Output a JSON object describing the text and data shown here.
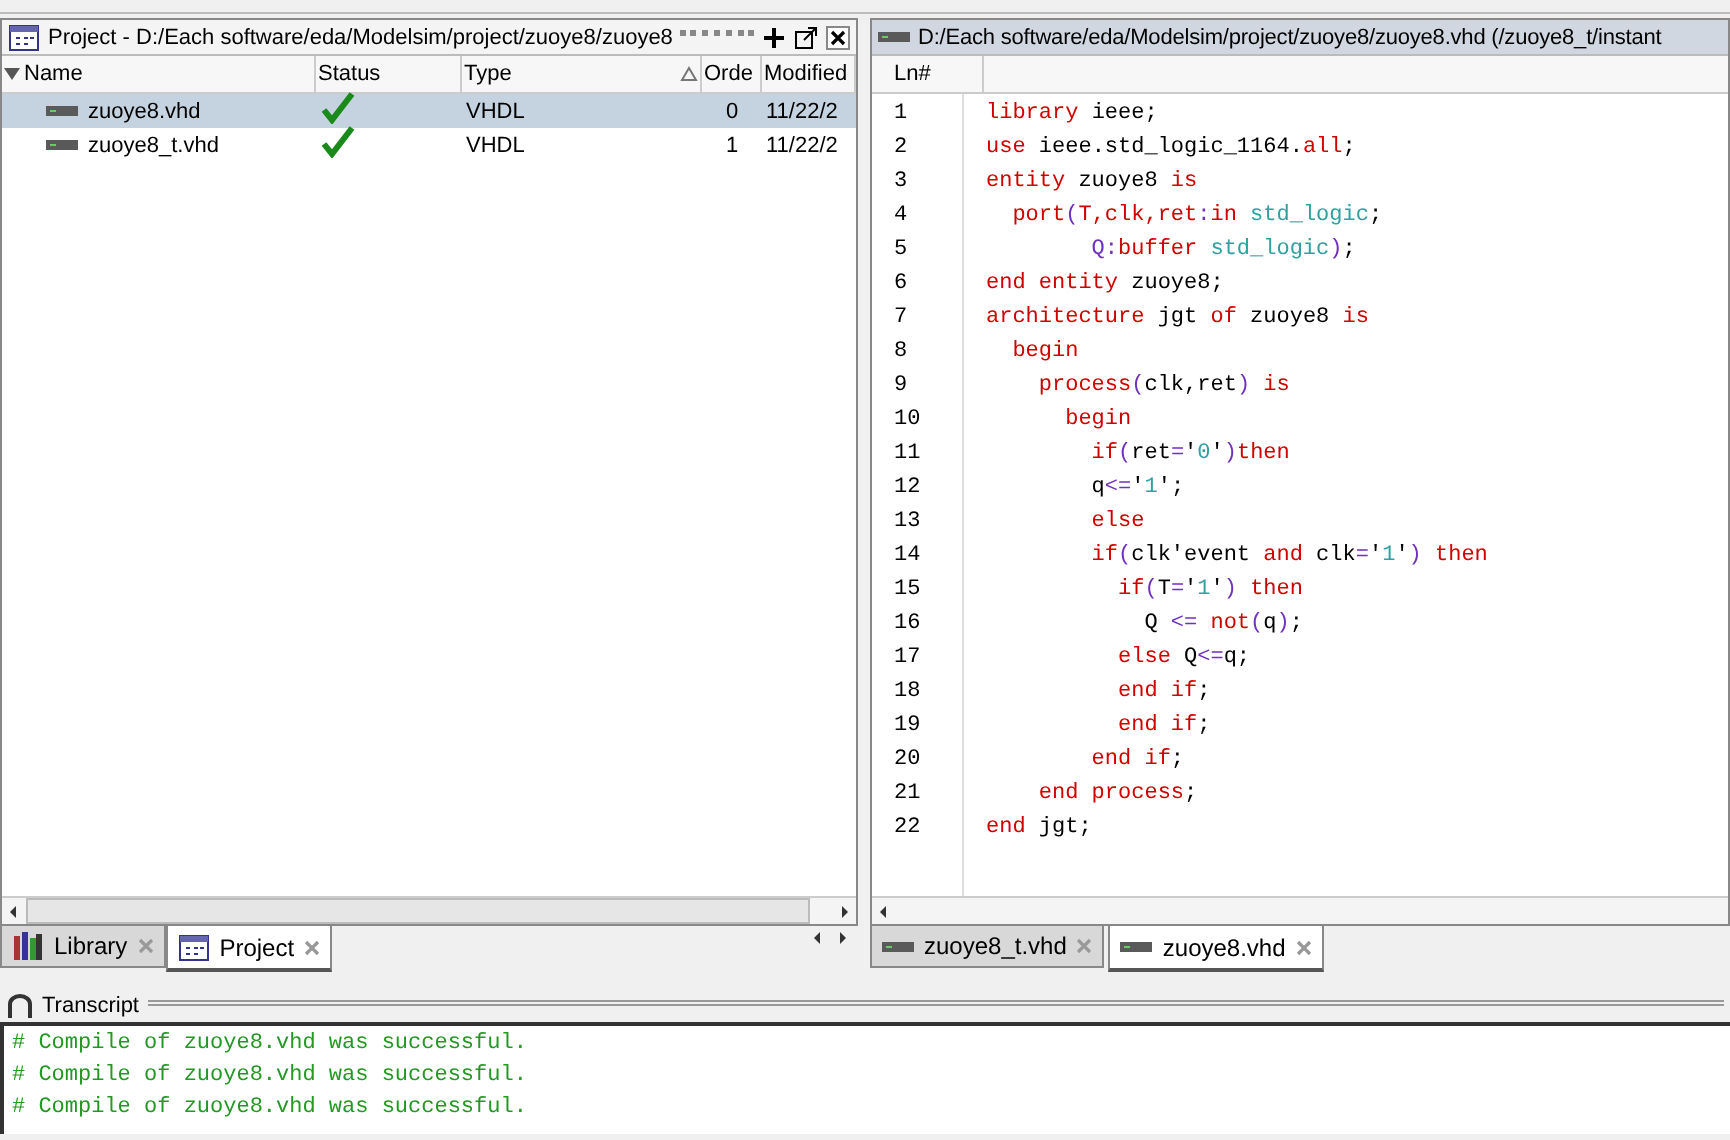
{
  "project_pane": {
    "title": "Project - D:/Each software/eda/Modelsim/project/zuoye8/zuoye8",
    "columns": [
      {
        "label": "Name",
        "sorted": false
      },
      {
        "label": "Status",
        "sorted": false
      },
      {
        "label": "Type",
        "sorted": true
      },
      {
        "label": "Orde",
        "sorted": false
      },
      {
        "label": "Modified",
        "sorted": false
      }
    ],
    "rows": [
      {
        "name": "zuoye8.vhd",
        "compiled": true,
        "type": "VHDL",
        "order": "0",
        "modified": "11/22/2",
        "selected": true
      },
      {
        "name": "zuoye8_t.vhd",
        "compiled": true,
        "type": "VHDL",
        "order": "1",
        "modified": "11/22/2",
        "selected": false
      }
    ],
    "tabs": [
      {
        "label": "Library",
        "kind": "library",
        "selected": false
      },
      {
        "label": "Project",
        "kind": "project",
        "selected": true
      }
    ]
  },
  "editor": {
    "title": "D:/Each software/eda/Modelsim/project/zuoye8/zuoye8.vhd (/zuoye8_t/instant",
    "line_header": "Ln#",
    "lines": [
      {
        "number": "1",
        "tokens": [
          {
            "kind": "keyword",
            "text": "library"
          },
          {
            "kind": "plain",
            "text": " ieee;"
          }
        ]
      },
      {
        "number": "2",
        "tokens": [
          {
            "kind": "keyword",
            "text": "use"
          },
          {
            "kind": "plain",
            "text": " ieee.std_logic_1164."
          },
          {
            "kind": "keyword",
            "text": "all"
          },
          {
            "kind": "plain",
            "text": ";"
          }
        ]
      },
      {
        "number": "3",
        "tokens": [
          {
            "kind": "keyword",
            "text": "entity"
          },
          {
            "kind": "plain",
            "text": " zuoye8 "
          },
          {
            "kind": "keyword",
            "text": "is"
          }
        ]
      },
      {
        "number": "4",
        "tokens": [
          {
            "kind": "keyword",
            "text": "  port"
          },
          {
            "kind": "symbol",
            "text": "("
          },
          {
            "kind": "keyword",
            "text": "T,clk,ret"
          },
          {
            "kind": "symbol",
            "text": ":"
          },
          {
            "kind": "keyword",
            "text": "in"
          },
          {
            "kind": "literal",
            "text": " std_logic"
          },
          {
            "kind": "plain",
            "text": ";"
          }
        ]
      },
      {
        "number": "5",
        "tokens": [
          {
            "kind": "symbol",
            "text": "        Q:"
          },
          {
            "kind": "keyword",
            "text": "buffer"
          },
          {
            "kind": "literal",
            "text": " std_logic"
          },
          {
            "kind": "symbol",
            "text": ")"
          },
          {
            "kind": "plain",
            "text": ";"
          }
        ]
      },
      {
        "number": "6",
        "tokens": [
          {
            "kind": "keyword",
            "text": "end entity"
          },
          {
            "kind": "plain",
            "text": " zuoye8;"
          }
        ]
      },
      {
        "number": "7",
        "tokens": [
          {
            "kind": "keyword",
            "text": "architecture"
          },
          {
            "kind": "plain",
            "text": " jgt "
          },
          {
            "kind": "keyword",
            "text": "of"
          },
          {
            "kind": "plain",
            "text": " zuoye8 "
          },
          {
            "kind": "keyword",
            "text": "is"
          }
        ]
      },
      {
        "number": "8",
        "tokens": [
          {
            "kind": "keyword",
            "text": "  begin"
          }
        ]
      },
      {
        "number": "9",
        "tokens": [
          {
            "kind": "keyword",
            "text": "    process"
          },
          {
            "kind": "symbol",
            "text": "("
          },
          {
            "kind": "plain",
            "text": "clk,ret"
          },
          {
            "kind": "symbol",
            "text": ")"
          },
          {
            "kind": "keyword",
            "text": " is"
          }
        ]
      },
      {
        "number": "10",
        "tokens": [
          {
            "kind": "keyword",
            "text": "      begin"
          }
        ]
      },
      {
        "number": "11",
        "tokens": [
          {
            "kind": "keyword",
            "text": "        if"
          },
          {
            "kind": "symbol",
            "text": "("
          },
          {
            "kind": "plain",
            "text": "ret"
          },
          {
            "kind": "symbol",
            "text": "="
          },
          {
            "kind": "plain",
            "text": "'"
          },
          {
            "kind": "literal",
            "text": "0"
          },
          {
            "kind": "plain",
            "text": "'"
          },
          {
            "kind": "symbol",
            "text": ")"
          },
          {
            "kind": "keyword",
            "text": "then"
          }
        ]
      },
      {
        "number": "12",
        "tokens": [
          {
            "kind": "plain",
            "text": "        q"
          },
          {
            "kind": "symbol",
            "text": "<="
          },
          {
            "kind": "plain",
            "text": "'"
          },
          {
            "kind": "literal",
            "text": "1"
          },
          {
            "kind": "plain",
            "text": "';"
          }
        ]
      },
      {
        "number": "13",
        "tokens": [
          {
            "kind": "keyword",
            "text": "        else"
          }
        ]
      },
      {
        "number": "14",
        "tokens": [
          {
            "kind": "keyword",
            "text": "        if"
          },
          {
            "kind": "symbol",
            "text": "("
          },
          {
            "kind": "plain",
            "text": "clk'event "
          },
          {
            "kind": "keyword",
            "text": "and"
          },
          {
            "kind": "plain",
            "text": " clk"
          },
          {
            "kind": "symbol",
            "text": "="
          },
          {
            "kind": "plain",
            "text": "'"
          },
          {
            "kind": "literal",
            "text": "1"
          },
          {
            "kind": "plain",
            "text": "'"
          },
          {
            "kind": "symbol",
            "text": ")"
          },
          {
            "kind": "keyword",
            "text": " then"
          }
        ]
      },
      {
        "number": "15",
        "tokens": [
          {
            "kind": "keyword",
            "text": "          if"
          },
          {
            "kind": "symbol",
            "text": "("
          },
          {
            "kind": "plain",
            "text": "T"
          },
          {
            "kind": "symbol",
            "text": "="
          },
          {
            "kind": "plain",
            "text": "'"
          },
          {
            "kind": "literal",
            "text": "1"
          },
          {
            "kind": "plain",
            "text": "'"
          },
          {
            "kind": "symbol",
            "text": ")"
          },
          {
            "kind": "keyword",
            "text": " then"
          }
        ]
      },
      {
        "number": "16",
        "tokens": [
          {
            "kind": "plain",
            "text": "            Q "
          },
          {
            "kind": "symbol",
            "text": "<="
          },
          {
            "kind": "keyword",
            "text": " not"
          },
          {
            "kind": "symbol",
            "text": "("
          },
          {
            "kind": "plain",
            "text": "q"
          },
          {
            "kind": "symbol",
            "text": ")"
          },
          {
            "kind": "plain",
            "text": ";"
          }
        ]
      },
      {
        "number": "17",
        "tokens": [
          {
            "kind": "keyword",
            "text": "          else"
          },
          {
            "kind": "plain",
            "text": " Q"
          },
          {
            "kind": "symbol",
            "text": "<="
          },
          {
            "kind": "plain",
            "text": "q;"
          }
        ]
      },
      {
        "number": "18",
        "tokens": [
          {
            "kind": "keyword",
            "text": "          end if"
          },
          {
            "kind": "plain",
            "text": ";"
          }
        ]
      },
      {
        "number": "19",
        "tokens": [
          {
            "kind": "keyword",
            "text": "          end if"
          },
          {
            "kind": "plain",
            "text": ";"
          }
        ]
      },
      {
        "number": "20",
        "tokens": [
          {
            "kind": "keyword",
            "text": "        end if"
          },
          {
            "kind": "plain",
            "text": ";"
          }
        ]
      },
      {
        "number": "21",
        "tokens": [
          {
            "kind": "keyword",
            "text": "    end process"
          },
          {
            "kind": "plain",
            "text": ";"
          }
        ]
      },
      {
        "number": "22",
        "tokens": [
          {
            "kind": "keyword",
            "text": "end"
          },
          {
            "kind": "plain",
            "text": " jgt;"
          }
        ]
      }
    ],
    "tabs": [
      {
        "label": "zuoye8_t.vhd",
        "selected": false
      },
      {
        "label": "zuoye8.vhd",
        "selected": true
      }
    ]
  },
  "transcript": {
    "title": "Transcript",
    "lines": [
      "# Compile of zuoye8.vhd was successful.",
      "# Compile of zuoye8.vhd was successful.",
      "# Compile of zuoye8.vhd was successful."
    ]
  }
}
